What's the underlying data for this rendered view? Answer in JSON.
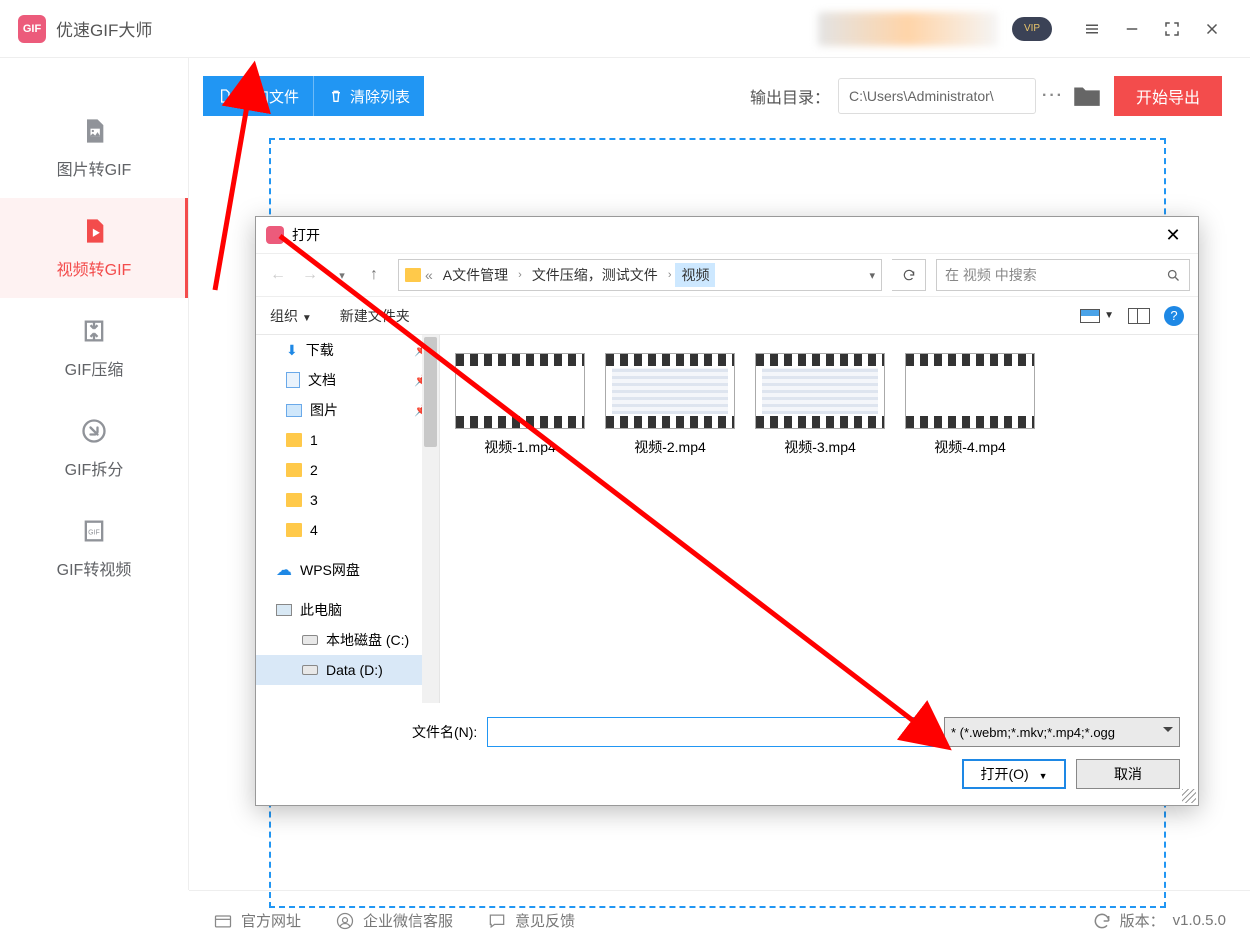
{
  "app": {
    "title": "优速GIF大师",
    "vip": "VIP"
  },
  "win": {
    "menu": "≡",
    "min": "—",
    "full": "⛶",
    "close": "✕"
  },
  "sidebar": {
    "items": [
      {
        "label": "图片转GIF"
      },
      {
        "label": "视频转GIF"
      },
      {
        "label": "GIF压缩"
      },
      {
        "label": "GIF拆分"
      },
      {
        "label": "GIF转视频"
      }
    ]
  },
  "toolbar": {
    "add": "添加文件",
    "clear": "清除列表",
    "out_label": "输出目录：",
    "out_path": "C:\\Users\\Administrator\\",
    "more": "···",
    "export": "开始导出"
  },
  "dialog": {
    "title": "打开",
    "path_segs": [
      "A文件管理",
      "文件压缩，测试文件",
      "视频"
    ],
    "search_placeholder": "在 视频 中搜索",
    "organize": "组织",
    "new_folder": "新建文件夹",
    "tree": [
      {
        "label": "下载",
        "pin": true,
        "icon": "dl"
      },
      {
        "label": "文档",
        "pin": true,
        "icon": "doc"
      },
      {
        "label": "图片",
        "pin": true,
        "icon": "pic"
      },
      {
        "label": "1",
        "icon": "folder"
      },
      {
        "label": "2",
        "icon": "folder"
      },
      {
        "label": "3",
        "icon": "folder"
      },
      {
        "label": "4",
        "icon": "folder"
      },
      {
        "label": "WPS网盘",
        "icon": "cloud",
        "root": true
      },
      {
        "label": "此电脑",
        "icon": "pc",
        "root": true
      },
      {
        "label": "本地磁盘 (C:)",
        "icon": "disk",
        "indent": true
      },
      {
        "label": "Data (D:)",
        "icon": "disk",
        "indent": true,
        "sel": true
      }
    ],
    "files": [
      {
        "name": "视频-1.mp4"
      },
      {
        "name": "视频-2.mp4"
      },
      {
        "name": "视频-3.mp4"
      },
      {
        "name": "视频-4.mp4"
      }
    ],
    "fn_label": "文件名(N):",
    "filter": "* (*.webm;*.mkv;*.mp4;*.ogg",
    "open_btn": "打开(O)",
    "cancel_btn": "取消"
  },
  "footer": {
    "site": "官方网址",
    "wechat": "企业微信客服",
    "feedback": "意见反馈",
    "ver_label": "版本：",
    "ver": "v1.0.5.0"
  }
}
